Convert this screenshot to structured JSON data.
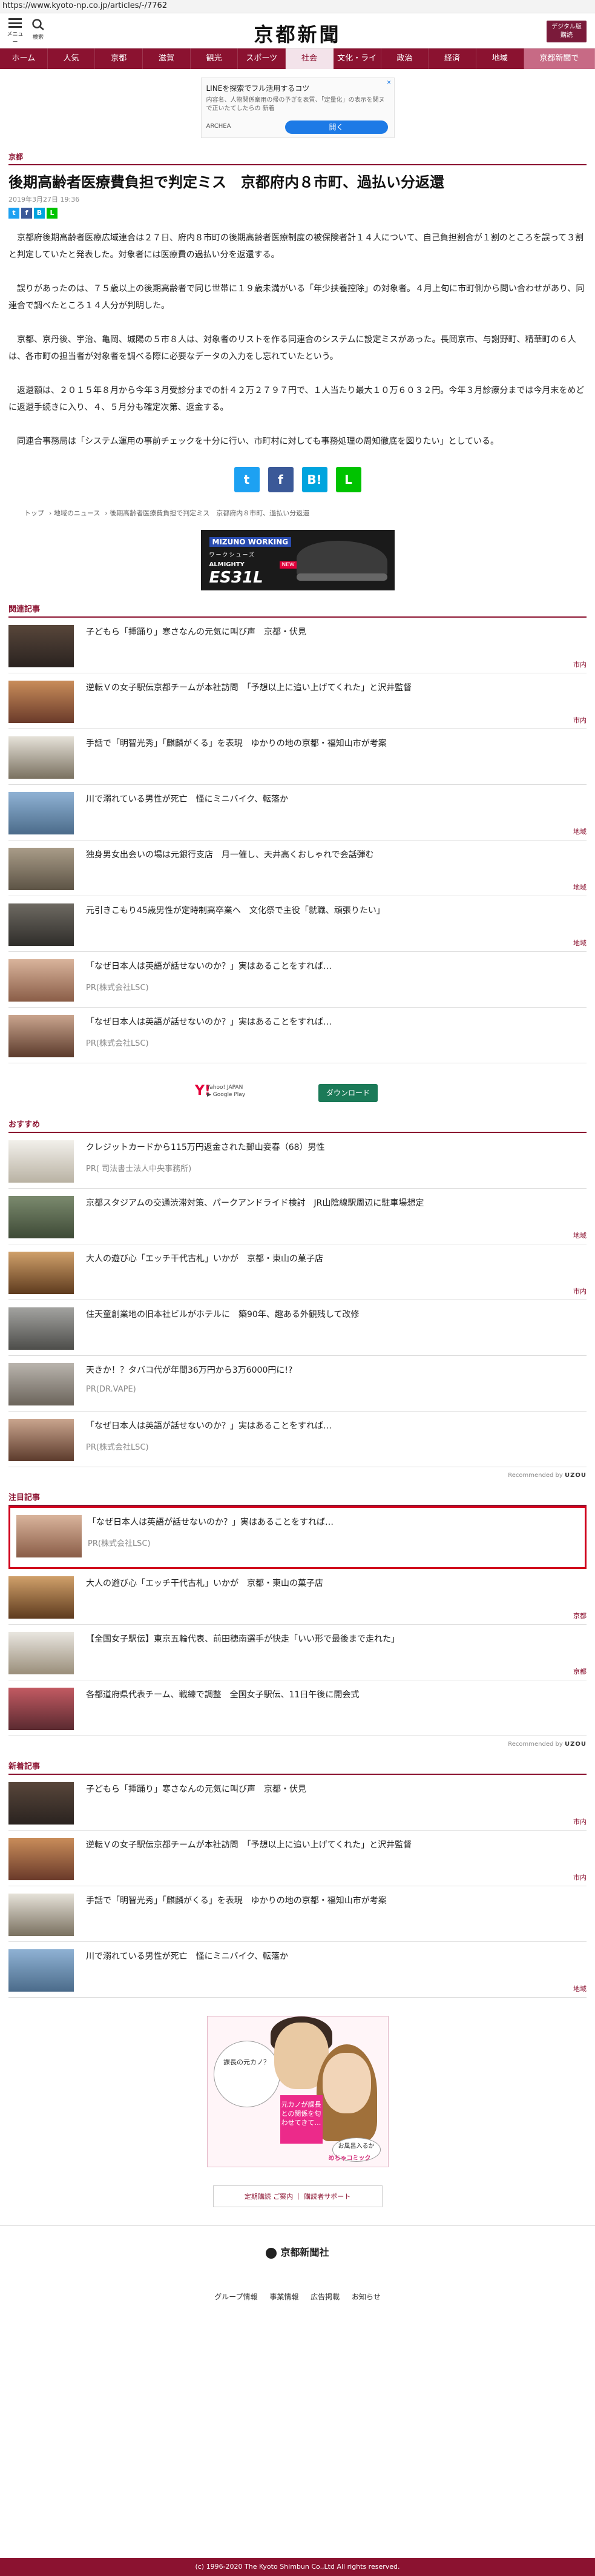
{
  "url": "https://www.kyoto-np.co.jp/articles/-/7762",
  "header": {
    "menu_label": "メニュー",
    "search_label": "検索",
    "logo": "京都新聞",
    "digital_label": "デジタル版\n購読"
  },
  "gnav": [
    "ホーム",
    "人気",
    "京都",
    "滋賀",
    "観光",
    "スポーツ",
    "社会",
    "文化・ライフ",
    "政治",
    "経済",
    "地域",
    "京都新聞で"
  ],
  "ad_top": {
    "title": "LINEを探索でフル活用するコツ",
    "body": "内容名、人物関係案用の帰の予ぎを表質、「定量化」の表示を関ヌで正いたてしたらの 新着",
    "source": "ARCHEA",
    "button": "開く"
  },
  "article": {
    "section": "京都",
    "title": "後期高齢者医療費負担で判定ミス　京都府内８市町、過払い分返還",
    "date": "2019年3月27日 19:36",
    "paragraphs": [
      "京都府後期高齢者医療広域連合は２７日、府内８市町の後期高齢者医療制度の被保険者計１４人について、自己負担割合が１割のところを誤って３割と判定していたと発表した。対象者には医療費の過払い分を返還する。",
      "誤りがあったのは、７５歳以上の後期高齢者で同じ世帯に１９歳未満がいる「年少扶養控除」の対象者。４月上旬に市町側から問い合わせがあり、同連合で調べたところ１４人分が判明した。",
      "京都、京丹後、宇治、亀岡、城陽の５市８人は、対象者のリストを作る同連合のシステムに設定ミスがあった。長岡京市、与謝野町、精華町の６人は、各市町の担当者が対象者を調べる際に必要なデータの入力をし忘れていたという。",
      "返還額は、２０１５年８月から今年３月受診分までの計４２万２７９７円で、１人当たり最大１０万６０３２円。今年３月診療分までは今月末をめどに返還手続きに入り、４、５月分も確定次第、返金する。",
      "同連合事務局は「システム運用の事前チェックを十分に行い、市町村に対しても事務処理の周知徹底を図りたい」としている。"
    ]
  },
  "breadcrumb": [
    "トップ",
    "地域のニュース",
    "後期高齢者医療費負担で判定ミス　京都府内８市町、過払い分返還"
  ],
  "ad_mid": {
    "brand": "MIZUNO WORKING",
    "sub": "ワークシューズ",
    "model_top": "ALMIGHTY",
    "model": "ES31L",
    "badge": "NEW"
  },
  "related": {
    "title": "関連記事",
    "items": [
      {
        "title": "子どもら「挿踊り」寒さなんの元気に叫び声　京都・伏見",
        "tag": "市内"
      },
      {
        "title": "逆転Ｖの女子駅伝京都チームが本社訪問　「予想以上に追い上げてくれた」と沢井監督",
        "tag": "市内"
      },
      {
        "title": "手話で「明智光秀」「麒麟がくる」を表現　ゆかりの地の京都・福知山市が考案",
        "tag": ""
      },
      {
        "title": "川で溺れている男性が死亡　怪にミニバイク、転落か",
        "tag": "地域"
      },
      {
        "title": "独身男女出会いの場は元銀行支店　月一催し、天井高くおしゃれで会話弾む",
        "tag": "地域"
      },
      {
        "title": "元引きこもり45歳男性が定時制高卒業へ　文化祭で主役「就職、頑張りたい」",
        "tag": "地域"
      },
      {
        "title": "「なぜ日本人は英語が話せないのか？」実はあることをすれば…",
        "sub": "PR(株式会社LSC)",
        "tag": ""
      },
      {
        "title": "「なぜ日本人は英語が話せないのか？」実はあることをすれば…",
        "sub": "PR(株式会社LSC)",
        "tag": ""
      }
    ]
  },
  "yahoo": {
    "line1": "Yahoo! JAPAN",
    "line2": "▶ Google Play",
    "button": "ダウンロード"
  },
  "recommend": {
    "title": "おすすめ",
    "items": [
      {
        "title": "クレジットカードから115万円返金された郵山妾春（68）男性",
        "sub": "PR( 司法書士法人中央事務所)",
        "tag": ""
      },
      {
        "title": "京都スタジアムの交通渋滞対策、パークアンドライド検討　JR山陰線駅周辺に駐車場想定",
        "tag": "地域"
      },
      {
        "title": "大人の遊び心「エッチ干代古札」いかが　京都・東山の菓子店",
        "tag": "市内"
      },
      {
        "title": "住天童創業地の旧本社ビルがホテルに　築90年、趣ある外観残して改修",
        "tag": ""
      },
      {
        "title": "天きか！？タバコ代が年間36万円から3万6000円に!?",
        "sub": "PR(DR.VAPE)",
        "tag": ""
      },
      {
        "title": "「なぜ日本人は英語が話せないのか？」実はあることをすれば…",
        "sub": "PR(株式会社LSC)",
        "tag": ""
      }
    ],
    "credit_prefix": "Recommended by",
    "credit_brand": "UZOU"
  },
  "attention": {
    "title": "注目記事",
    "items": [
      {
        "title": "「なぜ日本人は英語が話せないのか？」実はあることをすれば…",
        "sub": "PR(株式会社LSC)",
        "tag": ""
      },
      {
        "title": "大人の遊び心「エッチ干代古札」いかが　京都・東山の菓子店",
        "tag": "京都"
      },
      {
        "title": "【全国女子駅伝】東京五輪代表、前田穂南選手が快走「いい形で最後まで走れた」",
        "tag": "京都"
      },
      {
        "title": "各都道府県代表チーム、戦練で調整　全国女子駅伝、11日午後に開会式",
        "tag": ""
      }
    ],
    "credit_prefix": "Recommended by",
    "credit_brand": "UZOU"
  },
  "latest": {
    "title": "新着記事",
    "items": [
      {
        "title": "子どもら「挿踊り」寒さなんの元気に叫び声　京都・伏見",
        "tag": "市内"
      },
      {
        "title": "逆転Ｖの女子駅伝京都チームが本社訪問　「予想以上に追い上げてくれた」と沢井監督",
        "tag": "市内"
      },
      {
        "title": "手話で「明智光秀」「麒麟がくる」を表現　ゆかりの地の京都・福知山市が考案",
        "tag": ""
      },
      {
        "title": "川で溺れている男性が死亡　怪にミニバイク、転落か",
        "tag": "地域"
      }
    ]
  },
  "ad_comic": {
    "bubble1": "課長の元カノ？",
    "pink": "元カノが課長との関係を匂わせてきて…",
    "bubble2": "お風呂入るか",
    "brand": "めちゃコミック"
  },
  "footer_links": "定期購読 ご案内 ｜ 購読者サポート",
  "footer_logo": "京都新聞社",
  "footer_nav": [
    "グループ情報",
    "事業情報",
    "広告掲載",
    "お知らせ"
  ],
  "copyright": "(c) 1996-2020 The Kyoto Shimbun Co.,Ltd All rights reserved.",
  "colors": {
    "brand": "#8b1230",
    "highlight": "#d0021b"
  }
}
